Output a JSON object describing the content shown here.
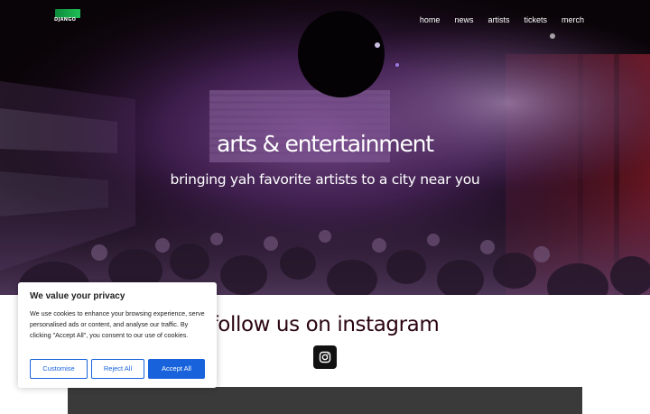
{
  "brand": {
    "logo_text": "DJANGO",
    "logo_color": "#1fbf57"
  },
  "nav": {
    "items": [
      {
        "label": "home"
      },
      {
        "label": "news"
      },
      {
        "label": "artists"
      },
      {
        "label": "tickets"
      },
      {
        "label": "merch"
      }
    ]
  },
  "hero": {
    "title": "arts & entertainment",
    "subtitle": "bringing yah favorite artists to a city near you",
    "image": "concert-crowd-photo"
  },
  "instagram": {
    "heading": "follow us on instagram",
    "icon": "instagram-icon"
  },
  "cookie_banner": {
    "title": "We value your privacy",
    "text": "We use cookies to enhance your browsing experience, serve personalised ads or content, and analyse our traffic. By clicking \"Accept All\", you consent to our use of cookies.",
    "customise_label": "Customise",
    "reject_label": "Reject All",
    "accept_label": "Accept All",
    "accent_color": "#1863dc"
  }
}
